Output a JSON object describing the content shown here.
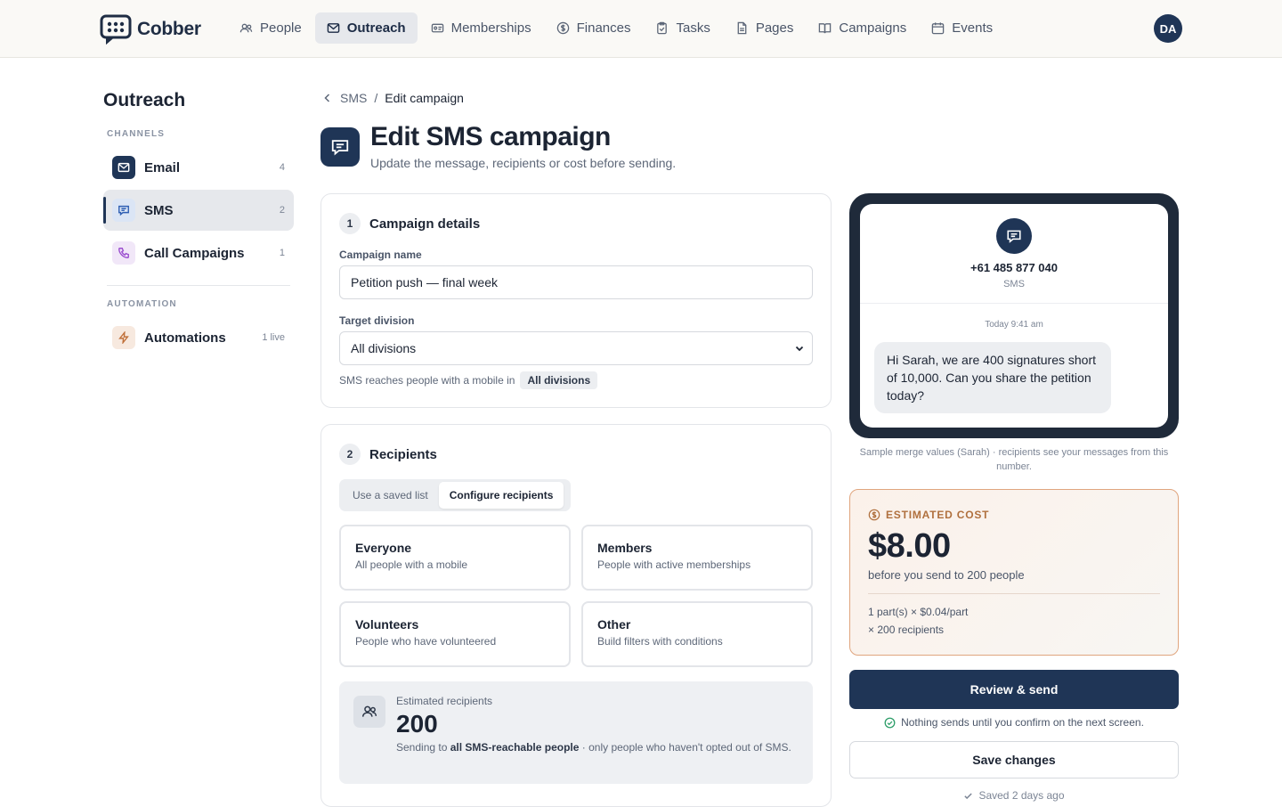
{
  "app": {
    "name": "Cobber",
    "user_initials": "DA"
  },
  "nav": [
    {
      "label": "People",
      "icon": "people-icon"
    },
    {
      "label": "Outreach",
      "icon": "mail-icon",
      "active": true
    },
    {
      "label": "Memberships",
      "icon": "card-icon"
    },
    {
      "label": "Finances",
      "icon": "dollar-icon"
    },
    {
      "label": "Tasks",
      "icon": "clipboard-icon"
    },
    {
      "label": "Pages",
      "icon": "page-icon"
    },
    {
      "label": "Campaigns",
      "icon": "book-icon"
    },
    {
      "label": "Events",
      "icon": "calendar-icon"
    }
  ],
  "sidebar": {
    "title": "Outreach",
    "channels_heading": "CHANNELS",
    "channels": [
      {
        "label": "Email",
        "count": "4",
        "icon": "mail-icon"
      },
      {
        "label": "SMS",
        "count": "2",
        "icon": "chat-icon",
        "active": true
      },
      {
        "label": "Call Campaigns",
        "count": "1",
        "icon": "phone-icon"
      }
    ],
    "automation_heading": "AUTOMATION",
    "automation": [
      {
        "label": "Automations",
        "count": "1 live",
        "icon": "bolt-icon"
      }
    ]
  },
  "breadcrumb": {
    "parent": "SMS",
    "separator": "/",
    "current": "Edit campaign"
  },
  "header": {
    "title": "Edit SMS campaign",
    "subtitle": "Update the message, recipients or cost before sending."
  },
  "details": {
    "step": "1",
    "title": "Campaign details",
    "name_label": "Campaign name",
    "name_value": "Petition push — final week",
    "division_label": "Target division",
    "division_value": "All divisions",
    "hint_text": "SMS reaches people with a mobile in",
    "hint_pill": "All divisions"
  },
  "recipients": {
    "step": "2",
    "title": "Recipients",
    "tabs": [
      "Use a saved list",
      "Configure recipients"
    ],
    "active_tab": 1,
    "options": [
      {
        "title": "Everyone",
        "desc": "All people with a mobile"
      },
      {
        "title": "Members",
        "desc": "People with active memberships"
      },
      {
        "title": "Volunteers",
        "desc": "People who have volunteered"
      },
      {
        "title": "Other",
        "desc": "Build filters with conditions"
      }
    ],
    "estimate_label": "Estimated recipients",
    "estimate_value": "200",
    "estimate_prefix": "Sending to ",
    "estimate_bold": "all SMS-reachable people",
    "estimate_suffix": " · only people who haven't opted out of SMS."
  },
  "preview": {
    "number": "+61 485 877 040",
    "channel": "SMS",
    "time": "Today 9:41 am",
    "message": "Hi Sarah, we are 400 signatures short of 10,000. Can you share the petition today?",
    "note": "Sample merge values (Sarah) · recipients see your messages from this number."
  },
  "cost": {
    "label": "ESTIMATED COST",
    "amount": "$8.00",
    "subtitle": "before you send to 200 people",
    "line1": "1 part(s) × $0.04/part",
    "line2": "× 200 recipients"
  },
  "actions": {
    "review": "Review & send",
    "confirm_note": "Nothing sends until you confirm on the next screen.",
    "save": "Save changes",
    "saved_note": "Saved 2 days ago"
  },
  "colors": {
    "primary": "#1f3556",
    "accent_cost": "#b0703e",
    "cost_border": "#e0a57e",
    "success": "#2f9e6a"
  }
}
